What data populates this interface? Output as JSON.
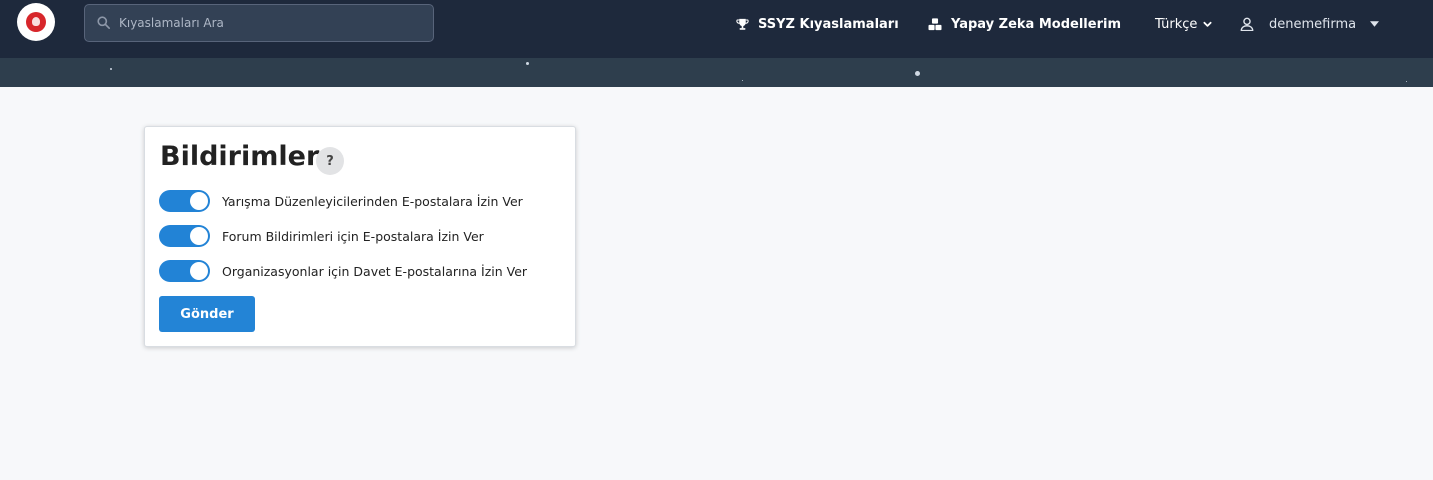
{
  "navbar": {
    "logo": "emblem-logo",
    "search": {
      "placeholder": "Kıyaslamaları Ara",
      "value": ""
    },
    "links": [
      {
        "label": "SSYZ Kıyaslamaları",
        "icon": "trophy-icon"
      },
      {
        "label": "Yapay Zeka Modellerim",
        "icon": "cubes-icon"
      }
    ],
    "language": {
      "label": "Türkçe",
      "icon": "chevron-down-icon"
    },
    "user": {
      "name": "denemefirma",
      "icon": "user-icon"
    }
  },
  "notifications": {
    "title": "Bildirimler",
    "help_label": "?",
    "toggles": [
      {
        "label": "Yarışma Düzenleyicilerinden E-postalara İzin Ver",
        "enabled": true
      },
      {
        "label": "Forum Bildirimleri için E-postalara İzin Ver",
        "enabled": true
      },
      {
        "label": "Organizasyonlar için Davet E-postalarına İzin Ver",
        "enabled": true
      }
    ],
    "submit_label": "Gönder"
  },
  "colors": {
    "navbar_bg": "#1e293c",
    "banner_bg": "#2e3e4d",
    "accent": "#2384d6",
    "page_bg": "#f7f8fa"
  }
}
